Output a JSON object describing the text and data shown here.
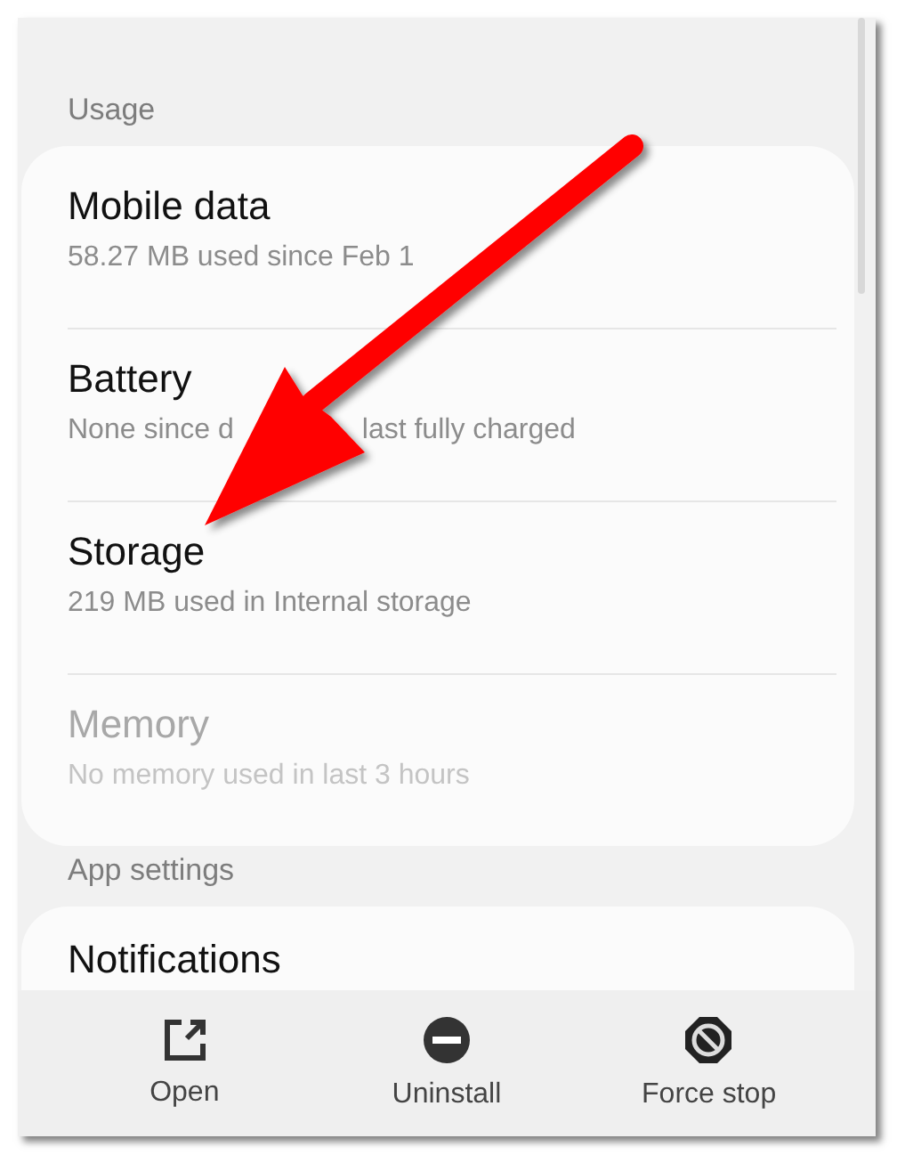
{
  "sections": [
    {
      "header": "Usage",
      "items": [
        {
          "title": "Mobile data",
          "subtitle_parts": [
            "58.27 MB used since Feb 1"
          ],
          "disabled": false
        },
        {
          "title": "Battery",
          "subtitle_parts": [
            "None since d",
            "last fully charged"
          ],
          "disabled": false
        },
        {
          "title": "Storage",
          "subtitle_parts": [
            "219 MB used in Internal storage"
          ],
          "disabled": false
        },
        {
          "title": "Memory",
          "subtitle_parts": [
            "No memory used in last 3 hours"
          ],
          "disabled": true
        }
      ]
    },
    {
      "header": "App settings",
      "items": [
        {
          "title": "Notifications",
          "disabled": false
        }
      ]
    }
  ],
  "bottom_bar": [
    {
      "kind": "open",
      "label": "Open"
    },
    {
      "kind": "uninstall",
      "label": "Uninstall"
    },
    {
      "kind": "force_stop",
      "label": "Force stop"
    }
  ],
  "annotation": {
    "kind": "arrow"
  }
}
